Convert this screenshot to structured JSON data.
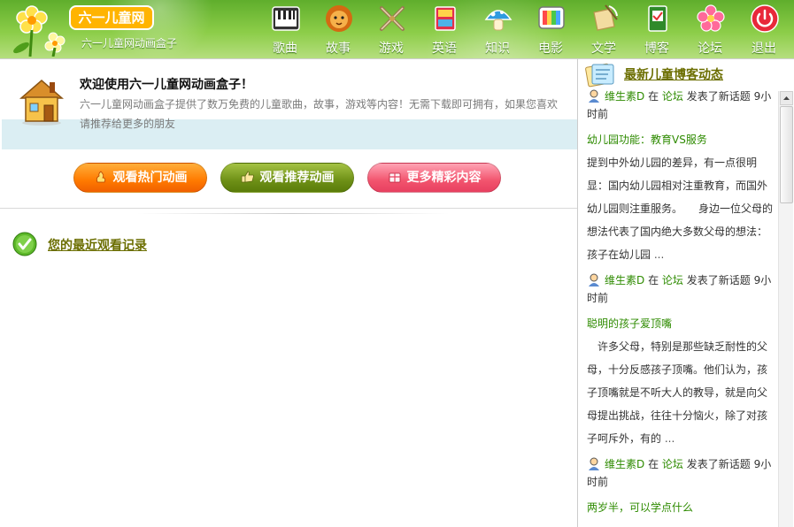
{
  "app": {
    "logo_text": "六一儿童网",
    "subtitle": "六一儿童网动画盒子"
  },
  "nav": [
    {
      "label": "歌曲",
      "icon": "piano-icon"
    },
    {
      "label": "故事",
      "icon": "lion-icon"
    },
    {
      "label": "游戏",
      "icon": "crossed-swords-icon"
    },
    {
      "label": "英语",
      "icon": "abc-book-icon"
    },
    {
      "label": "知识",
      "icon": "mushroom-icon"
    },
    {
      "label": "电影",
      "icon": "tv-icon"
    },
    {
      "label": "文学",
      "icon": "scroll-quill-icon"
    },
    {
      "label": "博客",
      "icon": "notebook-icon"
    },
    {
      "label": "论坛",
      "icon": "flower-icon"
    },
    {
      "label": "退出",
      "icon": "power-icon"
    }
  ],
  "welcome": {
    "title": "欢迎使用六一儿童网动画盒子！",
    "desc": "六一儿童网动画盒子提供了数万免费的儿童歌曲，故事，游戏等内容！无需下载即可拥有，如果您喜欢请推荐给更多的朋友"
  },
  "buttons": {
    "hot": "观看热门动画",
    "recommended": "观看推荐动画",
    "more": "更多精彩内容"
  },
  "recent": {
    "title": "您的最近观看记录"
  },
  "sidebar": {
    "title": "最新儿童博客动态",
    "posts": [
      {
        "user": "维生素D",
        "verb_in": "在",
        "place": "论坛",
        "action": "发表了新话题",
        "time": "9小时前",
        "title": "幼儿园功能：教育VS服务",
        "body": "提到中外幼儿园的差异，有一点很明显：国内幼儿园相对注重教育，而国外幼儿园则注重服务。　　身边一位父母的想法代表了国内绝大多数父母的想法：孩子在幼儿园",
        "ellipsis": "..."
      },
      {
        "user": "维生素D",
        "verb_in": "在",
        "place": "论坛",
        "action": "发表了新话题",
        "time": "9小时前",
        "title": "聪明的孩子爱顶嘴",
        "body": "　许多父母，特别是那些缺乏耐性的父母，十分反感孩子顶嘴。他们认为，孩子顶嘴就是不听大人的教导，就是向父母提出挑战，往往十分恼火，除了对孩子呵斥外，有的",
        "ellipsis": "..."
      },
      {
        "user": "维生素D",
        "verb_in": "在",
        "place": "论坛",
        "action": "发表了新话题",
        "time": "9小时前",
        "title": "两岁半，可以学点什么",
        "body": "",
        "ellipsis": ""
      }
    ]
  },
  "colors": {
    "header_green": "#7cc03a",
    "link_olive": "#6b6e00",
    "feed_green": "#2e8b00",
    "btn_orange": "#ff7a00",
    "btn_olive": "#6e9016",
    "btn_pink": "#f2546e",
    "band_blue": "#dbeef3"
  }
}
